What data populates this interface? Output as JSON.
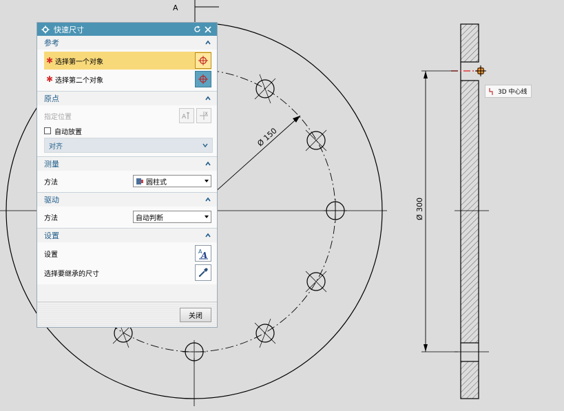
{
  "drawing": {
    "top_label": "A",
    "dim_pcd": "Ø 150",
    "dim_outer": "Ø 300",
    "tooltip": "3D 中心线"
  },
  "dialog": {
    "title": "快速尺寸",
    "sections": {
      "reference": {
        "header": "参考",
        "select_first": "选择第一个对象",
        "select_second": "选择第二个对象"
      },
      "origin": {
        "header": "原点",
        "specify_location": "指定位置",
        "auto_place": "自动放置",
        "align_option": "对齐"
      },
      "measure": {
        "header": "测量",
        "method_label": "方法",
        "method_value": "圆柱式"
      },
      "driving": {
        "header": "驱动",
        "method_label": "方法",
        "method_value": "自动判断"
      },
      "settings": {
        "header": "设置",
        "settings_label": "设置",
        "inherit_label": "选择要继承的尺寸"
      }
    },
    "close_label": "关闭"
  },
  "colors": {
    "title_bar": "#4a93b3",
    "section_header_text": "#1e5c8a",
    "active_row": "#f8d97a",
    "required_star": "#d62c2c",
    "centerline_highlight": "#e03a3a"
  }
}
